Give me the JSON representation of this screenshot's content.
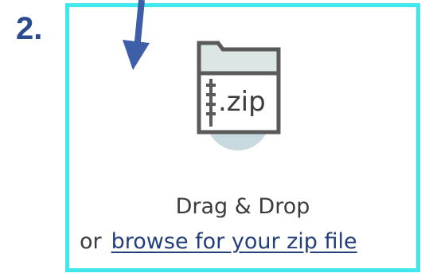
{
  "step": {
    "number_label": "2."
  },
  "dropzone": {
    "icon": "zip-file-folder-icon",
    "icon_text": ".zip",
    "title": "Drag & Drop",
    "or_text": "or",
    "browse_link": "browse for your zip file"
  },
  "colors": {
    "accent_border": "#3ee8ee",
    "step_blue": "#2b4a8f",
    "arrow_blue": "#3f5ea8",
    "icon_stroke": "#5a5a5a",
    "icon_folder": "#dce6e5",
    "icon_circle": "#c8dadf",
    "text": "#3c3c3c",
    "link": "#233f7a"
  }
}
